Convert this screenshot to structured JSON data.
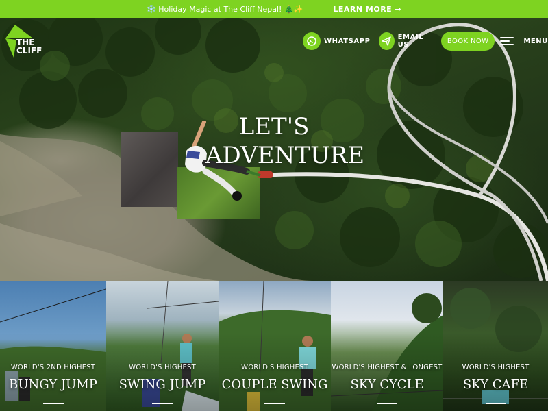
{
  "announcement": {
    "message": "❄️ Holiday Magic at The Cliff Nepal! 🎄✨",
    "cta_label": "LEARN MORE",
    "cta_arrow": "→"
  },
  "brand": {
    "logo_line1": "THE",
    "logo_line2": "CLIFF",
    "accent_color": "#7ed321"
  },
  "nav": {
    "whatsapp_label": "WHATSAPP",
    "whatsapp_icon": "whatsapp-icon",
    "email_label": "EMAIL US",
    "email_icon": "paper-plane-icon",
    "book_label": "BOOK NOW",
    "menu_label": "MENU",
    "menu_icon": "hamburger-icon"
  },
  "hero": {
    "title_line1": "LET'S",
    "title_line2": "ADVENTURE"
  },
  "activities": [
    {
      "subtitle": "WORLD'S 2ND HIGHEST",
      "name": "BUNGY JUMP"
    },
    {
      "subtitle": "WORLD'S HIGHEST",
      "name": "SWING JUMP"
    },
    {
      "subtitle": "WORLD'S HIGHEST",
      "name": "COUPLE SWING"
    },
    {
      "subtitle": "WORLD'S HIGHEST & LONGEST",
      "name": "SKY CYCLE"
    },
    {
      "subtitle": "WORLD'S HIGHEST",
      "name": "SKY CAFE"
    }
  ]
}
